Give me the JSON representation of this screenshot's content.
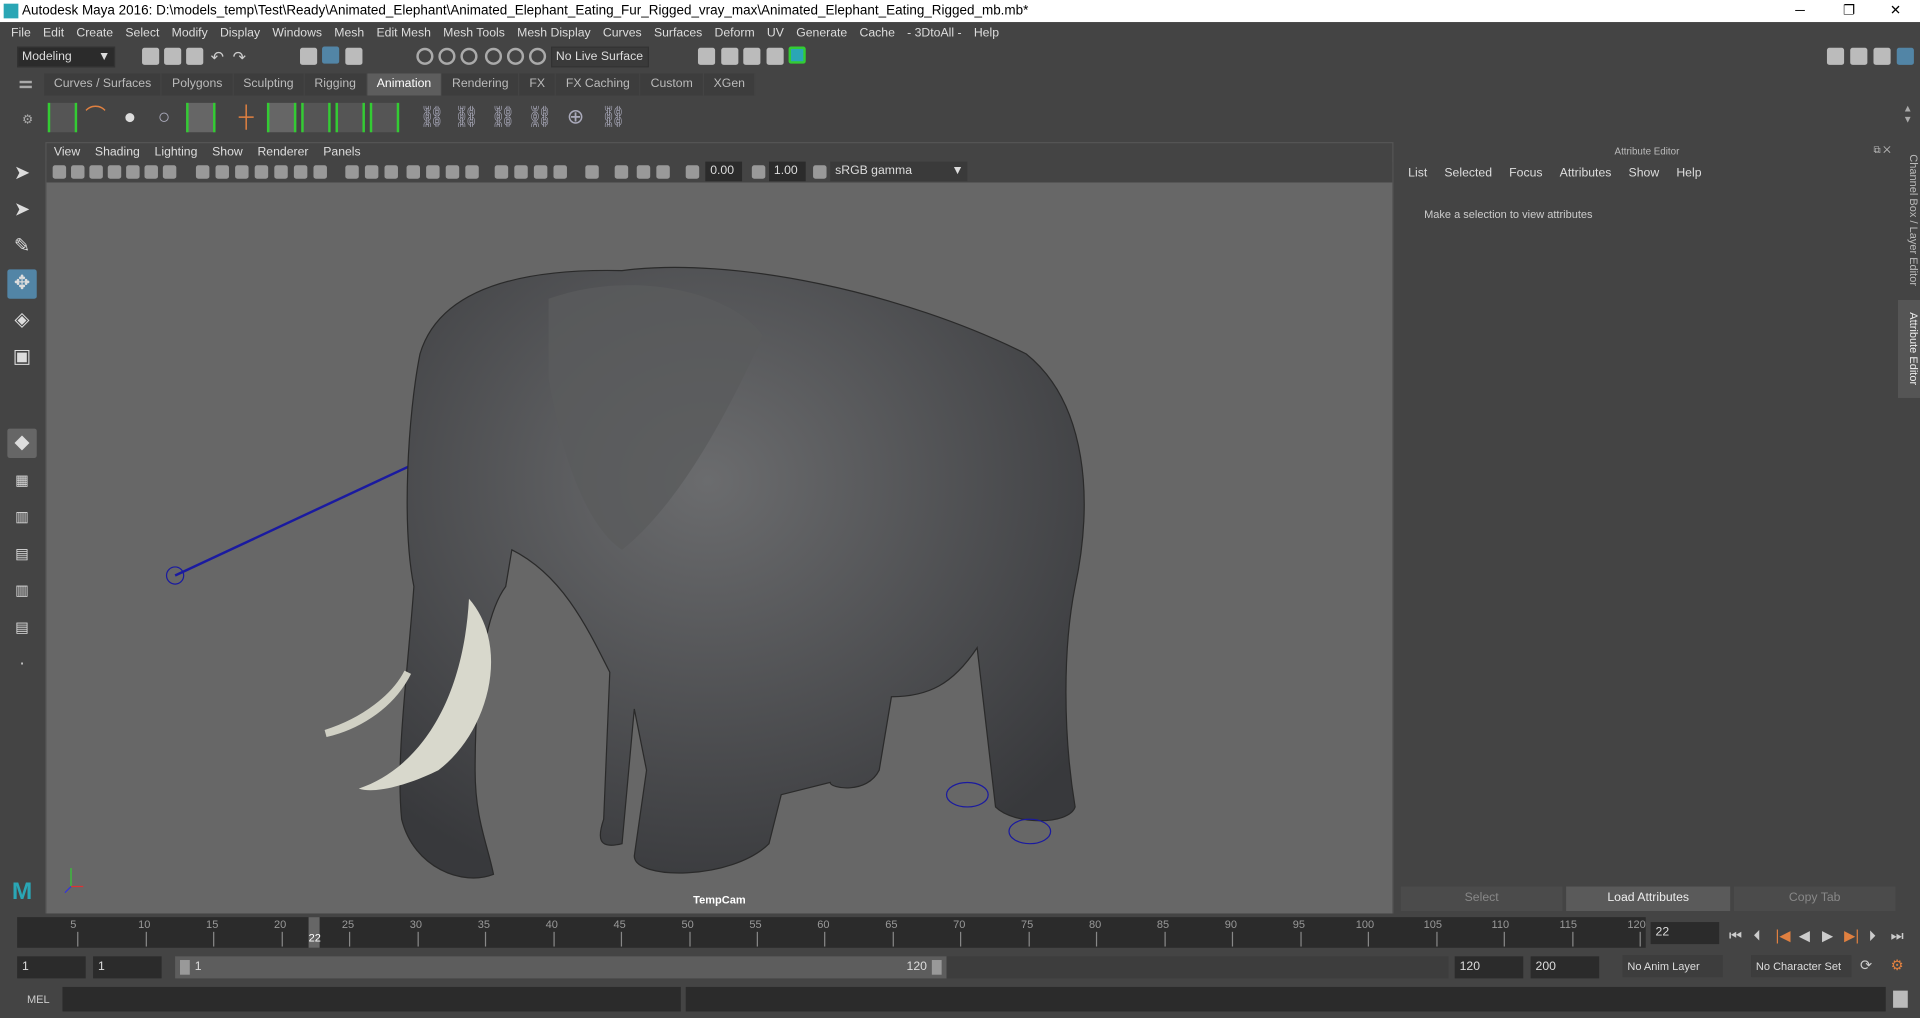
{
  "title": "Autodesk Maya 2016: D:\\models_temp\\Test\\Ready\\Animated_Elephant\\Animated_Elephant_Eating_Fur_Rigged_vray_max\\Animated_Elephant_Eating_Rigged_mb.mb*",
  "window_controls": {
    "minimize": "─",
    "maximize": "❐",
    "close": "✕"
  },
  "menu": [
    "File",
    "Edit",
    "Create",
    "Select",
    "Modify",
    "Display",
    "Windows",
    "Mesh",
    "Edit Mesh",
    "Mesh Tools",
    "Mesh Display",
    "Curves",
    "Surfaces",
    "Deform",
    "UV",
    "Generate",
    "Cache",
    "- 3DtoAll -",
    "Help"
  ],
  "toolbar": {
    "mode": "Modeling",
    "live_surface": "No Live Surface"
  },
  "shelf_tabs": [
    "Curves / Surfaces",
    "Polygons",
    "Sculpting",
    "Rigging",
    "Animation",
    "Rendering",
    "FX",
    "FX Caching",
    "Custom",
    "XGen"
  ],
  "active_shelf": "Animation",
  "panel_menu": [
    "View",
    "Shading",
    "Lighting",
    "Show",
    "Renderer",
    "Panels"
  ],
  "panel_fields": {
    "exposure": "0.00",
    "gamma": "1.00",
    "color_space": "sRGB gamma"
  },
  "viewport": {
    "camera": "TempCam",
    "bg": "#676767"
  },
  "attribute_editor": {
    "title": "Attribute Editor",
    "menu": [
      "List",
      "Selected",
      "Focus",
      "Attributes",
      "Show",
      "Help"
    ],
    "message": "Make a selection to view attributes",
    "buttons": [
      "Select",
      "Load Attributes",
      "Copy Tab"
    ]
  },
  "side_tabs": [
    "Channel Box / Layer Editor",
    "Attribute Editor"
  ],
  "timeline": {
    "ticks": [
      "5",
      "10",
      "15",
      "20",
      "25",
      "30",
      "35",
      "40",
      "45",
      "50",
      "55",
      "60",
      "65",
      "70",
      "75",
      "80",
      "85",
      "90",
      "95",
      "100",
      "105",
      "110",
      "115",
      "120"
    ],
    "current": "22",
    "current_field": "22"
  },
  "range": {
    "start": "1",
    "playback_start": "1",
    "slider_start": "1",
    "slider_end": "120",
    "playback_end": "120",
    "end": "200",
    "anim_layer": "No Anim Layer",
    "char_set": "No Character Set"
  },
  "command": {
    "label": "MEL"
  }
}
